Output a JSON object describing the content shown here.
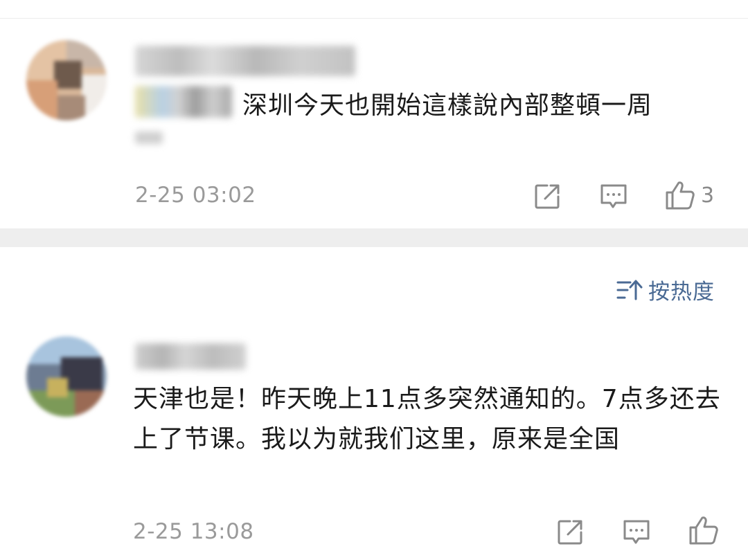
{
  "comments": [
    {
      "text": "深圳今天也開始這樣說內部整頓一周",
      "time": "2-25 03:02",
      "likes": "3"
    },
    {
      "text": "天津也是！昨天晚上11点多突然通知的。7点多还去上了节课。我以为就我们这里，原来是全国",
      "time": "2-25 13:08"
    }
  ],
  "sort": {
    "label": "按热度"
  },
  "colors": {
    "accent": "#4a6a94",
    "meta": "#9a9a9a",
    "icon": "#8a8a8a",
    "divider": "#eeeeee"
  }
}
